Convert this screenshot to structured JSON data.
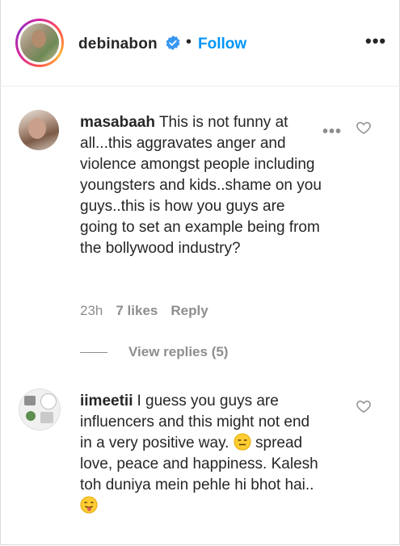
{
  "header": {
    "username": "debinabon",
    "separator": "•",
    "follow_label": "Follow",
    "more_label": "•••"
  },
  "comments": [
    {
      "username": "masabaah",
      "text": "This is not funny at all...this aggravates anger and violence amongst people including youngsters and kids..shame on you guys..this is how you guys are going to set an example being from the bollywood industry?",
      "time": "23h",
      "likes": "7 likes",
      "reply_label": "Reply",
      "more_label": "•••",
      "view_replies": "View replies (5)"
    },
    {
      "username": "iimeetii",
      "text_part1": "I guess you guys are influencers and this might not end in a very positive way.",
      "text_part2": "spread love, peace and happiness. Kalesh toh duniya mein pehle hi bhot hai..",
      "emoji1": "expressionless-face-emoji",
      "emoji2": "face-with-tongue-emoji"
    }
  ],
  "colors": {
    "link_blue": "#0095f6",
    "text": "#262626",
    "muted": "#8e8e8e",
    "verified_blue": "#3897f0"
  }
}
